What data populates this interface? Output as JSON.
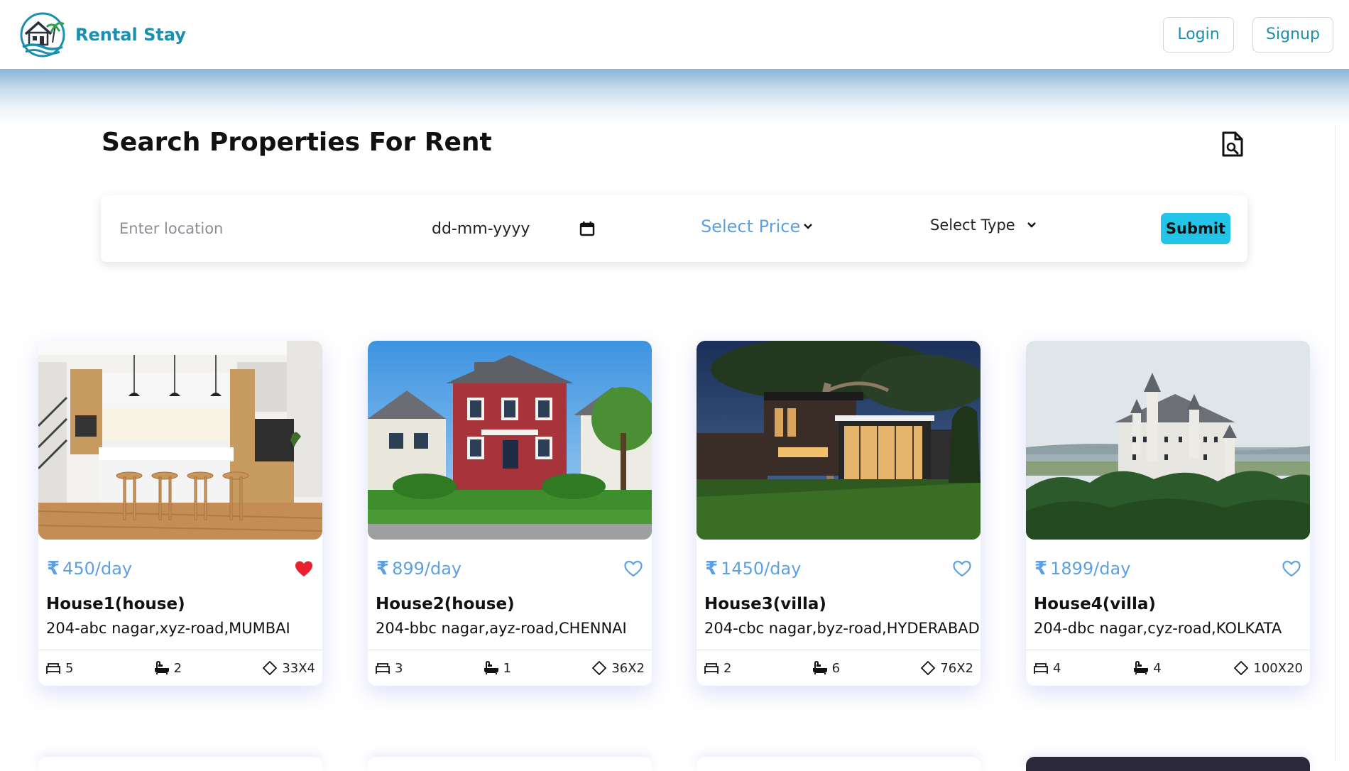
{
  "header": {
    "brand_name": "Rental Stay",
    "login_label": "Login",
    "signup_label": "Signup"
  },
  "page": {
    "title": "Search Properties For Rent",
    "doc_icon": "document-search-icon"
  },
  "search": {
    "location_placeholder": "Enter location",
    "date_value": "dd-mm-yyyy",
    "price_label": "Select Price",
    "type_label": "Select Type",
    "submit_label": "Submit"
  },
  "colors": {
    "brand": "#1a8fae",
    "price": "#5da0e2",
    "submit": "#22c5e8",
    "heart_filled": "#e8202f"
  },
  "currency_symbol": "₹",
  "properties": [
    {
      "price": "450/day",
      "name": "House1(house)",
      "address": "204-abc nagar,xyz-road,MUMBAI",
      "beds": "5",
      "baths": "2",
      "area": "33X4",
      "favorite": true,
      "image": "kitchen-interior"
    },
    {
      "price": "899/day",
      "name": "House2(house)",
      "address": "204-bbc nagar,ayz-road,CHENNAI",
      "beds": "3",
      "baths": "1",
      "area": "36X2",
      "favorite": false,
      "image": "red-suburban-house"
    },
    {
      "price": "1450/day",
      "name": "House3(villa)",
      "address": "204-cbc nagar,byz-road,HYDERABAD",
      "beds": "2",
      "baths": "6",
      "area": "76X2",
      "favorite": false,
      "image": "modern-villa-night"
    },
    {
      "price": "1899/day",
      "name": "House4(villa)",
      "address": "204-dbc nagar,cyz-road,KOLKATA",
      "beds": "4",
      "baths": "4",
      "area": "100X20",
      "favorite": false,
      "image": "castle-on-hill"
    }
  ]
}
